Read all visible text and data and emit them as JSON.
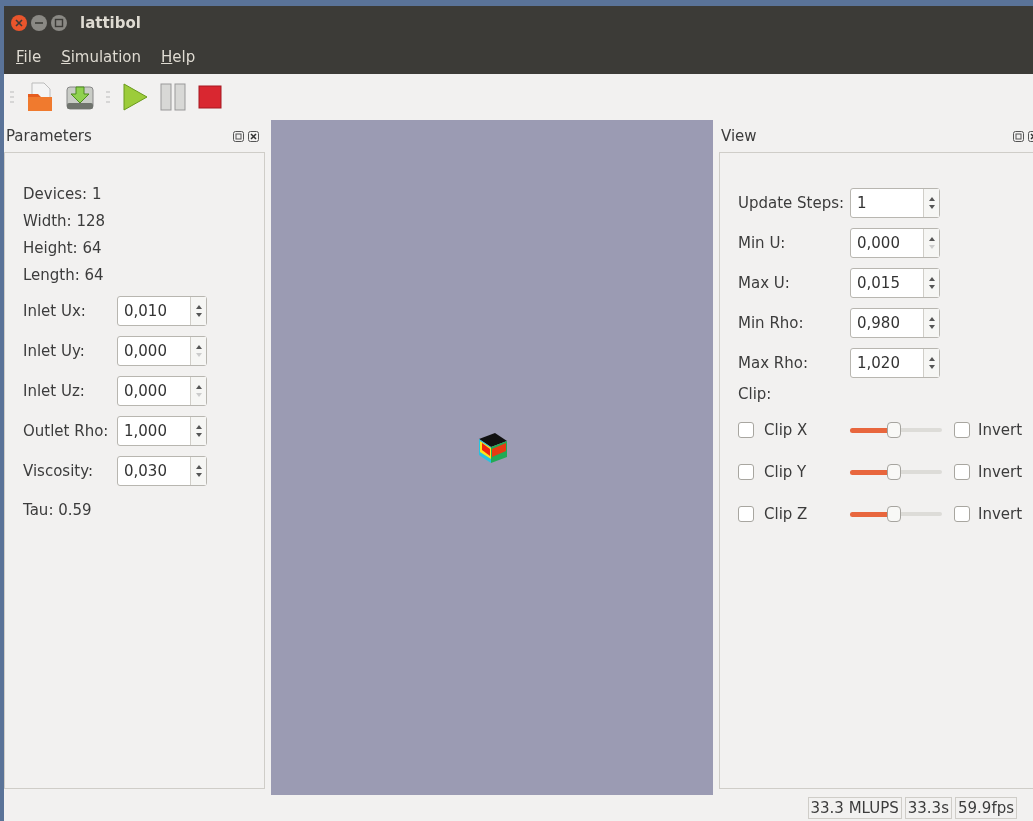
{
  "window": {
    "title": "lattibol"
  },
  "menu": [
    {
      "label": "File"
    },
    {
      "label": "Simulation"
    },
    {
      "label": "Help"
    }
  ],
  "toolbar": [
    {
      "kind": "open"
    },
    {
      "kind": "save"
    },
    {
      "kind": "separator"
    },
    {
      "kind": "play"
    },
    {
      "kind": "pause"
    },
    {
      "kind": "stop"
    }
  ],
  "parameters": {
    "title": "Parameters",
    "info": [
      "Devices: 1",
      "Width: 128",
      "Height: 64",
      "Length: 64"
    ],
    "fields": [
      {
        "label": "Inlet Ux:",
        "value": "0,010",
        "down_disabled": false
      },
      {
        "label": "Inlet Uy:",
        "value": "0,000",
        "down_disabled": true
      },
      {
        "label": "Inlet Uz:",
        "value": "0,000",
        "down_disabled": true
      },
      {
        "label": "Outlet Rho:",
        "value": "1,000",
        "down_disabled": false
      },
      {
        "label": "Viscosity:",
        "value": "0,030",
        "down_disabled": false
      }
    ],
    "footer": "Tau: 0.59"
  },
  "view": {
    "title": "View",
    "fields": [
      {
        "label": "Update Steps:",
        "value": "1",
        "down_disabled": false
      },
      {
        "label": "Min U:",
        "value": "0,000",
        "down_disabled": true
      },
      {
        "label": "Max U:",
        "value": "0,015",
        "down_disabled": false
      },
      {
        "label": "Min Rho:",
        "value": "0,980",
        "down_disabled": false
      },
      {
        "label": "Max Rho:",
        "value": "1,020",
        "down_disabled": false
      }
    ],
    "clip_label": "Clip:",
    "clips": [
      {
        "label": "Clip X",
        "checked": false,
        "level": 0.48,
        "invert_label": "Invert",
        "invert": false
      },
      {
        "label": "Clip Y",
        "checked": false,
        "level": 0.48,
        "invert_label": "Invert",
        "invert": false
      },
      {
        "label": "Clip Z",
        "checked": false,
        "level": 0.48,
        "invert_label": "Invert",
        "invert": false
      }
    ]
  },
  "status_bar": [
    "33.3 MLUPS",
    "33.3s",
    "59.9fps"
  ]
}
